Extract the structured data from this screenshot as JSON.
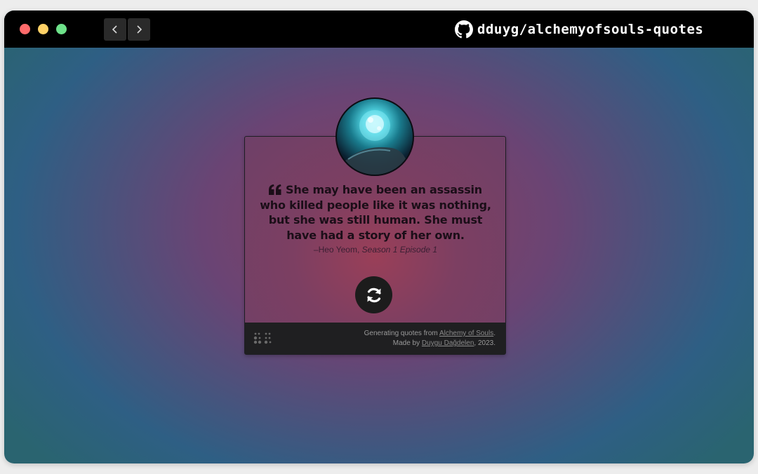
{
  "browser": {
    "repo_label": "dduyg/alchemyofsouls-quotes",
    "icons": [
      "close-dot",
      "minimize-dot",
      "maximize-dot",
      "chevron-left-icon",
      "chevron-right-icon",
      "github-icon"
    ]
  },
  "quote": {
    "text": "She may have been an assassin who killed people like it was nothing, but she was still human. She must have had a story of her own.",
    "author": "–Heo Yeom,",
    "episode": "Season 1 Episode 1"
  },
  "footer": {
    "prefix": "Generating quotes from ",
    "show_link": "Alchemy of Souls",
    "middle": ". Made by ",
    "author_link": "Duygu Dağdelen",
    "suffix": ", 2023."
  },
  "colors": {
    "titlebar": "#000000",
    "card_border": "#1e1e24",
    "footer_bg": "#1f1f21",
    "refresh_bg": "#1c1c1c"
  }
}
